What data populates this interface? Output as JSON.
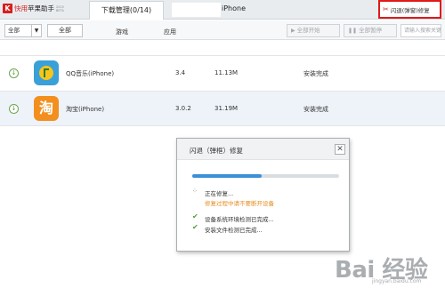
{
  "topbar": {
    "logo_mark": "K",
    "logo_prefix": "快用",
    "logo_suffix": "苹果助手",
    "logo_version": "2015 BETA",
    "download_tab": "下载管理(0/14)",
    "device_name": "iPhone",
    "repair_button": "闪退(弹窗)修复",
    "repair_icon": "wrench-icon"
  },
  "filters": {
    "type_select": "全部",
    "categories": [
      "全部",
      "游戏",
      "应用"
    ],
    "start_all": "全部开始",
    "pause_all": "全部暂停",
    "search_placeholder": "请输入搜索关键字"
  },
  "downloads": [
    {
      "name": "QQ音乐(iPhone)",
      "version": "3.4",
      "size": "11.13M",
      "status": "安装完成",
      "icon": "qq-music-icon"
    },
    {
      "name": "淘宝(iPhone)",
      "version": "3.0.2",
      "size": "31.19M",
      "status": "安装完成",
      "icon": "taobao-icon",
      "icon_char": "淘"
    }
  ],
  "dialog": {
    "title": "闪退（弹框）修复",
    "close": "✕",
    "progress": 0.47,
    "repairing": "正在修复...",
    "warning": "修复过程中请不要断开设备",
    "steps": [
      "设备系统环境检测已完成...",
      "安装文件检测已完成..."
    ]
  },
  "watermark": {
    "main": "Bai 经验",
    "sub": "jingyan.baidu.com"
  },
  "colors": {
    "accent_red": "#e01919",
    "progress_blue": "#3b8fd8",
    "warning_orange": "#e78a1e",
    "check_green": "#4aa332"
  }
}
